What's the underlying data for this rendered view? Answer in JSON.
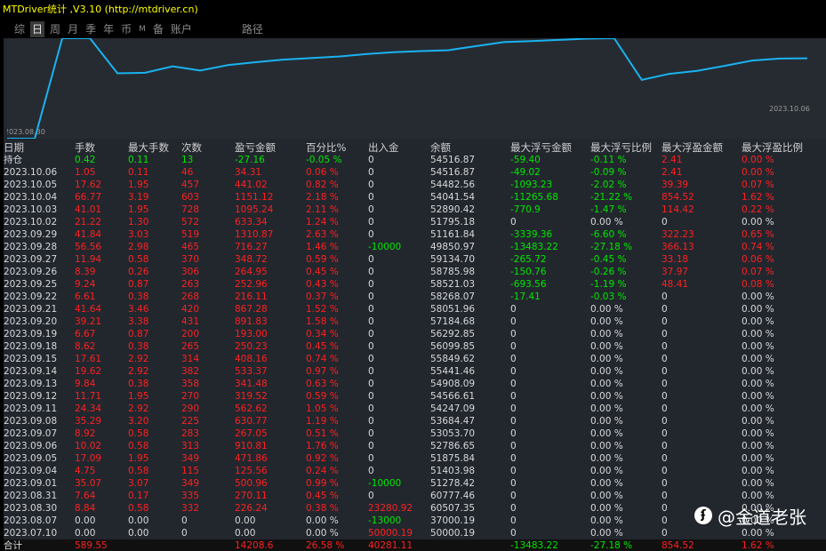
{
  "window": {
    "title": "MTDriver统计 ,V3.10 (http://mtdriver.cn)"
  },
  "tabs": [
    {
      "label": "综"
    },
    {
      "label": "日"
    },
    {
      "label": "周"
    },
    {
      "label": "月"
    },
    {
      "label": "季"
    },
    {
      "label": "年"
    },
    {
      "label": "币"
    },
    {
      "label": "M"
    },
    {
      "label": "备"
    },
    {
      "label": "账户"
    },
    {
      "label": "路径"
    }
  ],
  "active_tab": 1,
  "colors": {
    "positive": "#00e800",
    "negative": "#ff2020",
    "neutral": "#d8d8d8",
    "curve": "#19b3f0",
    "title": "#ffff00"
  },
  "chart_data": {
    "type": "line",
    "x_start_label": "2023.08.30",
    "x_end_label": "2023.10.06",
    "series": [
      {
        "values": [
          37000.19,
          37000.19,
          60507.35,
          60777.46,
          51278.42,
          51403.98,
          52786.65,
          51875.84,
          53053.7,
          53684.47,
          54247.09,
          54566.61,
          54908.09,
          55441.46,
          55849.62,
          56099.85,
          56292.85,
          57184.68,
          58051.96,
          58268.07,
          58521.03,
          58785.98,
          59134.7,
          49850.97,
          51161.84,
          51795.18,
          52890.42,
          54041.54,
          54482.56,
          54516.87
        ]
      }
    ]
  },
  "table": {
    "headers": [
      "日期",
      "手数",
      "最大手数",
      "次数",
      "盈亏金额",
      "百分比%",
      "出入金",
      "余额",
      "最大浮亏金额",
      "最大浮亏比例",
      "最大浮盈金额",
      "最大浮盈比例"
    ],
    "rows": [
      {
        "c": [
          "持仓",
          "0.42",
          "0.11",
          "13",
          "-27.16",
          "-0.05 %",
          "0",
          "54516.87",
          "-59.40",
          "-0.11 %",
          "2.41",
          "0.00 %"
        ],
        "k": [
          "n",
          "g",
          "g",
          "g",
          "g",
          "g",
          "n",
          "n",
          "g",
          "g",
          "r",
          "r"
        ]
      },
      {
        "c": [
          "2023.10.06",
          "1.05",
          "0.11",
          "46",
          "34.31",
          "0.06 %",
          "0",
          "54516.87",
          "-49.02",
          "-0.09 %",
          "2.41",
          "0.00 %"
        ],
        "k": [
          "n",
          "r",
          "r",
          "r",
          "r",
          "r",
          "n",
          "n",
          "g",
          "g",
          "r",
          "r"
        ]
      },
      {
        "c": [
          "2023.10.05",
          "17.62",
          "1.95",
          "457",
          "441.02",
          "0.82 %",
          "0",
          "54482.56",
          "-1093.23",
          "-2.02 %",
          "39.39",
          "0.07 %"
        ],
        "k": [
          "n",
          "r",
          "r",
          "r",
          "r",
          "r",
          "n",
          "n",
          "g",
          "g",
          "r",
          "r"
        ]
      },
      {
        "c": [
          "2023.10.04",
          "66.77",
          "3.19",
          "603",
          "1151.12",
          "2.18 %",
          "0",
          "54041.54",
          "-11265.68",
          "-21.22 %",
          "854.52",
          "1.62 %"
        ],
        "k": [
          "n",
          "r",
          "r",
          "r",
          "r",
          "r",
          "n",
          "n",
          "g",
          "g",
          "r",
          "r"
        ]
      },
      {
        "c": [
          "2023.10.03",
          "41.01",
          "1.95",
          "728",
          "1095.24",
          "2.11 %",
          "0",
          "52890.42",
          "-770.9",
          "-1.47 %",
          "114.42",
          "0.22 %"
        ],
        "k": [
          "n",
          "r",
          "r",
          "r",
          "r",
          "r",
          "n",
          "n",
          "g",
          "g",
          "r",
          "r"
        ]
      },
      {
        "c": [
          "2023.10.02",
          "21.22",
          "1.30",
          "572",
          "633.34",
          "1.24 %",
          "0",
          "51795.18",
          "0",
          "0.00 %",
          "0",
          "0.00 %"
        ],
        "k": [
          "n",
          "r",
          "r",
          "r",
          "r",
          "r",
          "n",
          "n",
          "n",
          "n",
          "n",
          "n"
        ]
      },
      {
        "c": [
          "2023.09.29",
          "41.84",
          "3.03",
          "519",
          "1310.87",
          "2.63 %",
          "0",
          "51161.84",
          "-3339.36",
          "-6.60 %",
          "322.23",
          "0.65 %"
        ],
        "k": [
          "n",
          "r",
          "r",
          "r",
          "r",
          "r",
          "n",
          "n",
          "g",
          "g",
          "r",
          "r"
        ]
      },
      {
        "c": [
          "2023.09.28",
          "56.56",
          "2.98",
          "465",
          "716.27",
          "1.46 %",
          "-10000",
          "49850.97",
          "-13483.22",
          "-27.18 %",
          "366.13",
          "0.74 %"
        ],
        "k": [
          "n",
          "r",
          "r",
          "r",
          "r",
          "r",
          "g",
          "n",
          "g",
          "g",
          "r",
          "r"
        ]
      },
      {
        "c": [
          "2023.09.27",
          "11.94",
          "0.58",
          "370",
          "348.72",
          "0.59 %",
          "0",
          "59134.70",
          "-265.72",
          "-0.45 %",
          "33.18",
          "0.06 %"
        ],
        "k": [
          "n",
          "r",
          "r",
          "r",
          "r",
          "r",
          "n",
          "n",
          "g",
          "g",
          "r",
          "r"
        ]
      },
      {
        "c": [
          "2023.09.26",
          "8.39",
          "0.26",
          "306",
          "264.95",
          "0.45 %",
          "0",
          "58785.98",
          "-150.76",
          "-0.26 %",
          "37.97",
          "0.07 %"
        ],
        "k": [
          "n",
          "r",
          "r",
          "r",
          "r",
          "r",
          "n",
          "n",
          "g",
          "g",
          "r",
          "r"
        ]
      },
      {
        "c": [
          "2023.09.25",
          "9.24",
          "0.87",
          "263",
          "252.96",
          "0.43 %",
          "0",
          "58521.03",
          "-693.56",
          "-1.19 %",
          "48.41",
          "0.08 %"
        ],
        "k": [
          "n",
          "r",
          "r",
          "r",
          "r",
          "r",
          "n",
          "n",
          "g",
          "g",
          "r",
          "r"
        ]
      },
      {
        "c": [
          "2023.09.22",
          "6.61",
          "0.38",
          "268",
          "216.11",
          "0.37 %",
          "0",
          "58268.07",
          "-17.41",
          "-0.03 %",
          "0",
          "0.00 %"
        ],
        "k": [
          "n",
          "r",
          "r",
          "r",
          "r",
          "r",
          "n",
          "n",
          "g",
          "g",
          "n",
          "n"
        ]
      },
      {
        "c": [
          "2023.09.21",
          "41.64",
          "3.46",
          "420",
          "867.28",
          "1.52 %",
          "0",
          "58051.96",
          "0",
          "0.00 %",
          "0",
          "0.00 %"
        ],
        "k": [
          "n",
          "r",
          "r",
          "r",
          "r",
          "r",
          "n",
          "n",
          "n",
          "n",
          "n",
          "n"
        ]
      },
      {
        "c": [
          "2023.09.20",
          "39.21",
          "3.38",
          "431",
          "891.83",
          "1.58 %",
          "0",
          "57184.68",
          "0",
          "0.00 %",
          "0",
          "0.00 %"
        ],
        "k": [
          "n",
          "r",
          "r",
          "r",
          "r",
          "r",
          "n",
          "n",
          "n",
          "n",
          "n",
          "n"
        ]
      },
      {
        "c": [
          "2023.09.19",
          "6.67",
          "0.87",
          "200",
          "193.00",
          "0.34 %",
          "0",
          "56292.85",
          "0",
          "0.00 %",
          "0",
          "0.00 %"
        ],
        "k": [
          "n",
          "r",
          "r",
          "r",
          "r",
          "r",
          "n",
          "n",
          "n",
          "n",
          "n",
          "n"
        ]
      },
      {
        "c": [
          "2023.09.18",
          "8.62",
          "0.38",
          "265",
          "250.23",
          "0.45 %",
          "0",
          "56099.85",
          "0",
          "0.00 %",
          "0",
          "0.00 %"
        ],
        "k": [
          "n",
          "r",
          "r",
          "r",
          "r",
          "r",
          "n",
          "n",
          "n",
          "n",
          "n",
          "n"
        ]
      },
      {
        "c": [
          "2023.09.15",
          "17.61",
          "2.92",
          "314",
          "408.16",
          "0.74 %",
          "0",
          "55849.62",
          "0",
          "0.00 %",
          "0",
          "0.00 %"
        ],
        "k": [
          "n",
          "r",
          "r",
          "r",
          "r",
          "r",
          "n",
          "n",
          "n",
          "n",
          "n",
          "n"
        ]
      },
      {
        "c": [
          "2023.09.14",
          "19.62",
          "2.92",
          "382",
          "533.37",
          "0.97 %",
          "0",
          "55441.46",
          "0",
          "0.00 %",
          "0",
          "0.00 %"
        ],
        "k": [
          "n",
          "r",
          "r",
          "r",
          "r",
          "r",
          "n",
          "n",
          "n",
          "n",
          "n",
          "n"
        ]
      },
      {
        "c": [
          "2023.09.13",
          "9.84",
          "0.38",
          "358",
          "341.48",
          "0.63 %",
          "0",
          "54908.09",
          "0",
          "0.00 %",
          "0",
          "0.00 %"
        ],
        "k": [
          "n",
          "r",
          "r",
          "r",
          "r",
          "r",
          "n",
          "n",
          "n",
          "n",
          "n",
          "n"
        ]
      },
      {
        "c": [
          "2023.09.12",
          "11.71",
          "1.95",
          "270",
          "319.52",
          "0.59 %",
          "0",
          "54566.61",
          "0",
          "0.00 %",
          "0",
          "0.00 %"
        ],
        "k": [
          "n",
          "r",
          "r",
          "r",
          "r",
          "r",
          "n",
          "n",
          "n",
          "n",
          "n",
          "n"
        ]
      },
      {
        "c": [
          "2023.09.11",
          "24.34",
          "2.92",
          "290",
          "562.62",
          "1.05 %",
          "0",
          "54247.09",
          "0",
          "0.00 %",
          "0",
          "0.00 %"
        ],
        "k": [
          "n",
          "r",
          "r",
          "r",
          "r",
          "r",
          "n",
          "n",
          "n",
          "n",
          "n",
          "n"
        ]
      },
      {
        "c": [
          "2023.09.08",
          "35.29",
          "3.20",
          "225",
          "630.77",
          "1.19 %",
          "0",
          "53684.47",
          "0",
          "0.00 %",
          "0",
          "0.00 %"
        ],
        "k": [
          "n",
          "r",
          "r",
          "r",
          "r",
          "r",
          "n",
          "n",
          "n",
          "n",
          "n",
          "n"
        ]
      },
      {
        "c": [
          "2023.09.07",
          "8.92",
          "0.58",
          "283",
          "267.05",
          "0.51 %",
          "0",
          "53053.70",
          "0",
          "0.00 %",
          "0",
          "0.00 %"
        ],
        "k": [
          "n",
          "r",
          "r",
          "r",
          "r",
          "r",
          "n",
          "n",
          "n",
          "n",
          "n",
          "n"
        ]
      },
      {
        "c": [
          "2023.09.06",
          "10.02",
          "0.58",
          "313",
          "910.81",
          "1.76 %",
          "0",
          "52786.65",
          "0",
          "0.00 %",
          "0",
          "0.00 %"
        ],
        "k": [
          "n",
          "r",
          "r",
          "r",
          "r",
          "r",
          "n",
          "n",
          "n",
          "n",
          "n",
          "n"
        ]
      },
      {
        "c": [
          "2023.09.05",
          "17.09",
          "1.95",
          "349",
          "471.86",
          "0.92 %",
          "0",
          "51875.84",
          "0",
          "0.00 %",
          "0",
          "0.00 %"
        ],
        "k": [
          "n",
          "r",
          "r",
          "r",
          "r",
          "r",
          "n",
          "n",
          "n",
          "n",
          "n",
          "n"
        ]
      },
      {
        "c": [
          "2023.09.04",
          "4.75",
          "0.58",
          "115",
          "125.56",
          "0.24 %",
          "0",
          "51403.98",
          "0",
          "0.00 %",
          "0",
          "0.00 %"
        ],
        "k": [
          "n",
          "r",
          "r",
          "r",
          "r",
          "r",
          "n",
          "n",
          "n",
          "n",
          "n",
          "n"
        ]
      },
      {
        "c": [
          "2023.09.01",
          "35.07",
          "3.07",
          "349",
          "500.96",
          "0.99 %",
          "-10000",
          "51278.42",
          "0",
          "0.00 %",
          "0",
          "0.00 %"
        ],
        "k": [
          "n",
          "r",
          "r",
          "r",
          "r",
          "r",
          "g",
          "n",
          "n",
          "n",
          "n",
          "n"
        ]
      },
      {
        "c": [
          "2023.08.31",
          "7.64",
          "0.17",
          "335",
          "270.11",
          "0.45 %",
          "0",
          "60777.46",
          "0",
          "0.00 %",
          "0",
          "0.00 %"
        ],
        "k": [
          "n",
          "r",
          "r",
          "r",
          "r",
          "r",
          "n",
          "n",
          "n",
          "n",
          "n",
          "n"
        ]
      },
      {
        "c": [
          "2023.08.30",
          "8.84",
          "0.58",
          "332",
          "226.24",
          "0.38 %",
          "23280.92",
          "60507.35",
          "0",
          "0.00 %",
          "0",
          "0.00 %"
        ],
        "k": [
          "n",
          "r",
          "r",
          "r",
          "r",
          "r",
          "r",
          "n",
          "n",
          "n",
          "n",
          "n"
        ]
      },
      {
        "c": [
          "2023.08.07",
          "0.00",
          "0.00",
          "0",
          "0.00",
          "0.00 %",
          "-13000",
          "37000.19",
          "0",
          "0.00 %",
          "0",
          "0.00 %"
        ],
        "k": [
          "n",
          "n",
          "n",
          "n",
          "n",
          "n",
          "g",
          "n",
          "n",
          "n",
          "n",
          "n"
        ]
      },
      {
        "c": [
          "2023.07.10",
          "0.00",
          "0.00",
          "0",
          "0.00",
          "0.00 %",
          "50000.19",
          "50000.19",
          "0",
          "0.00 %",
          "0",
          "0.00 %"
        ],
        "k": [
          "n",
          "n",
          "n",
          "n",
          "n",
          "n",
          "r",
          "n",
          "n",
          "n",
          "n",
          "n"
        ]
      }
    ],
    "total": {
      "c": [
        "合计",
        "589.55",
        "",
        "",
        "14208.6",
        "26.58 %",
        "40281.11",
        "",
        "-13483.22",
        "-27.18 %",
        "854.52",
        "1.62 %"
      ],
      "k": [
        "n",
        "r",
        "n",
        "n",
        "r",
        "r",
        "r",
        "n",
        "g",
        "g",
        "r",
        "r"
      ]
    }
  },
  "watermark": {
    "icon": "weibo-icon",
    "text": "@金道老张"
  }
}
